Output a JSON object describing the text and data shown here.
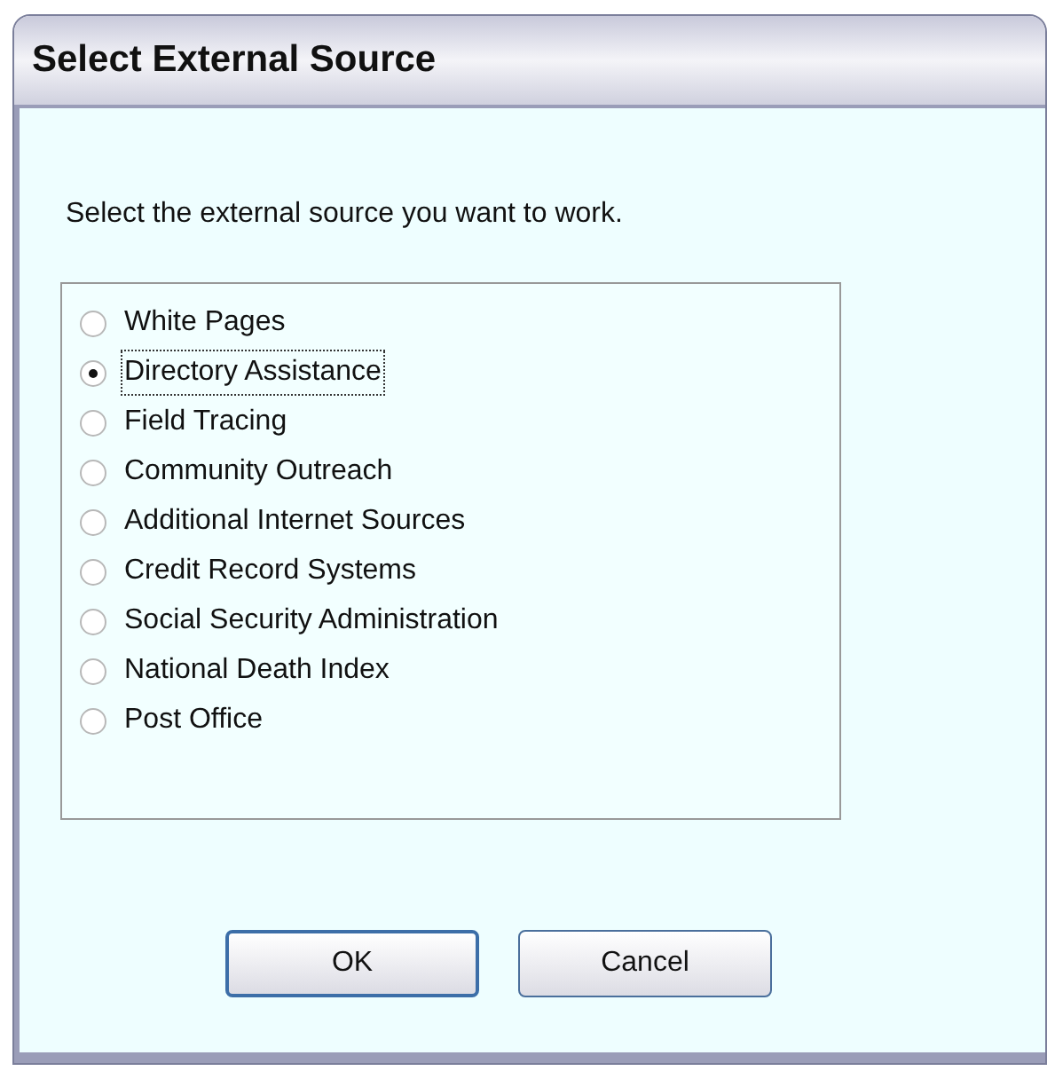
{
  "window": {
    "title": "Select External Source"
  },
  "prompt": "Select the external source you want to work.",
  "options": [
    {
      "label": "White Pages",
      "selected": false
    },
    {
      "label": "Directory Assistance",
      "selected": true
    },
    {
      "label": "Field Tracing",
      "selected": false
    },
    {
      "label": "Community Outreach",
      "selected": false
    },
    {
      "label": "Additional Internet Sources",
      "selected": false
    },
    {
      "label": "Credit Record Systems",
      "selected": false
    },
    {
      "label": "Social Security Administration",
      "selected": false
    },
    {
      "label": "National Death Index",
      "selected": false
    },
    {
      "label": "Post Office",
      "selected": false
    }
  ],
  "buttons": [
    {
      "label": "OK",
      "default": true
    },
    {
      "label": "Cancel",
      "default": false
    }
  ]
}
